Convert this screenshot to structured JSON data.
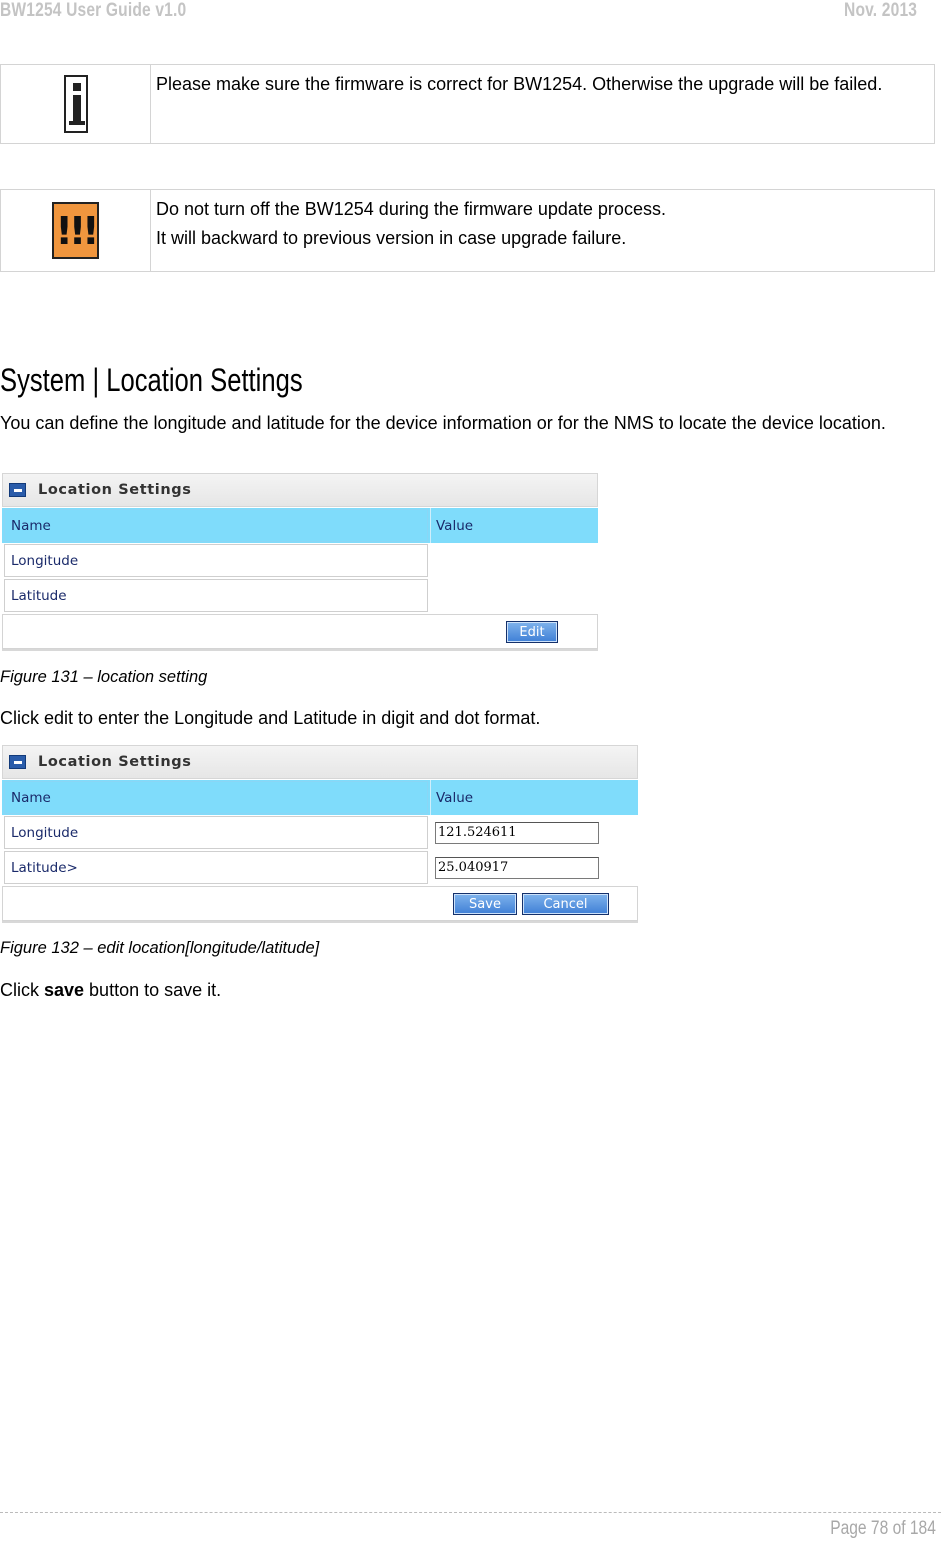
{
  "header": {
    "left": "BW1254 User Guide v1.0",
    "right": "Nov.  2013"
  },
  "notes": {
    "info": {
      "icon": "info-icon",
      "text": "Please make sure the firmware is correct for BW1254. Otherwise the upgrade will be failed."
    },
    "warning": {
      "icon": "warning-icon",
      "glyph": "!!!",
      "line1": "Do not turn off the BW1254 during the firmware update process.",
      "line2": "It will backward to previous version in case upgrade failure."
    }
  },
  "section": {
    "title": "System | Location Settings",
    "intro": "You can define the longitude and latitude for the device information or for the NMS to locate the device location."
  },
  "figure1": {
    "panel_title": "Location Settings",
    "col_name": "Name",
    "col_value": "Value",
    "rows": [
      "Longitude",
      "Latitude"
    ],
    "edit_button": "Edit",
    "caption": "Figure 131 – location setting"
  },
  "instruction": "Click edit to enter the Longitude and Latitude in digit and dot format.",
  "figure2": {
    "panel_title": "Location Settings",
    "col_name": "Name",
    "col_value": "Value",
    "longitude_label": "Longitude",
    "longitude_value": "121.524611",
    "latitude_label": "Latitude>",
    "latitude_value": "25.040917",
    "save_button": "Save",
    "cancel_button": "Cancel",
    "caption": "Figure 132 – edit location[longitude/latitude]"
  },
  "closing": {
    "prefix": "Click ",
    "bold": "save",
    "suffix": " button to save it."
  },
  "footer": {
    "page": "Page 78 of 184"
  },
  "colors": {
    "table_header": "#7fdcfb",
    "button": "#3f7fd6",
    "warning_icon": "#f0963e"
  }
}
